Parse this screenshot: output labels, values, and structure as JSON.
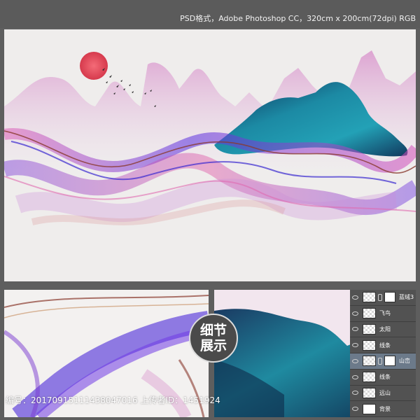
{
  "header": {
    "file_info": "PSD格式，Adobe Photoshop CC，320cm x 200cm(72dpi) RGB"
  },
  "badge": {
    "line1": "细节",
    "line2": "展示"
  },
  "layers_panel": {
    "items": [
      {
        "label": "蓝绒3",
        "thumb": "checker",
        "has_mask": true,
        "active": false
      },
      {
        "label": "飞鸟",
        "thumb": "checker",
        "has_mask": false,
        "active": false
      },
      {
        "label": "太阳",
        "thumb": "checker",
        "has_mask": false,
        "active": false
      },
      {
        "label": "线条",
        "thumb": "checker",
        "has_mask": false,
        "active": false
      },
      {
        "label": "山峦",
        "thumb": "checker",
        "has_mask": true,
        "active": true
      },
      {
        "label": "线条",
        "thumb": "checker",
        "has_mask": false,
        "active": false
      },
      {
        "label": "远山",
        "thumb": "checker",
        "has_mask": false,
        "active": false
      },
      {
        "label": "背景",
        "thumb": "white",
        "has_mask": false,
        "active": false
      }
    ]
  },
  "footer": {
    "text": "编号：20170915111438047016 上传者ID：1451924"
  },
  "colors": {
    "sun": "#e0495a",
    "mountain_teal": "#1f8fa6",
    "mountain_dark": "#0e2a4a",
    "ribbon_purple": "#4b2ad8",
    "ribbon_pink": "#e04fb5",
    "ribbon_brown": "#8a3a2e"
  }
}
